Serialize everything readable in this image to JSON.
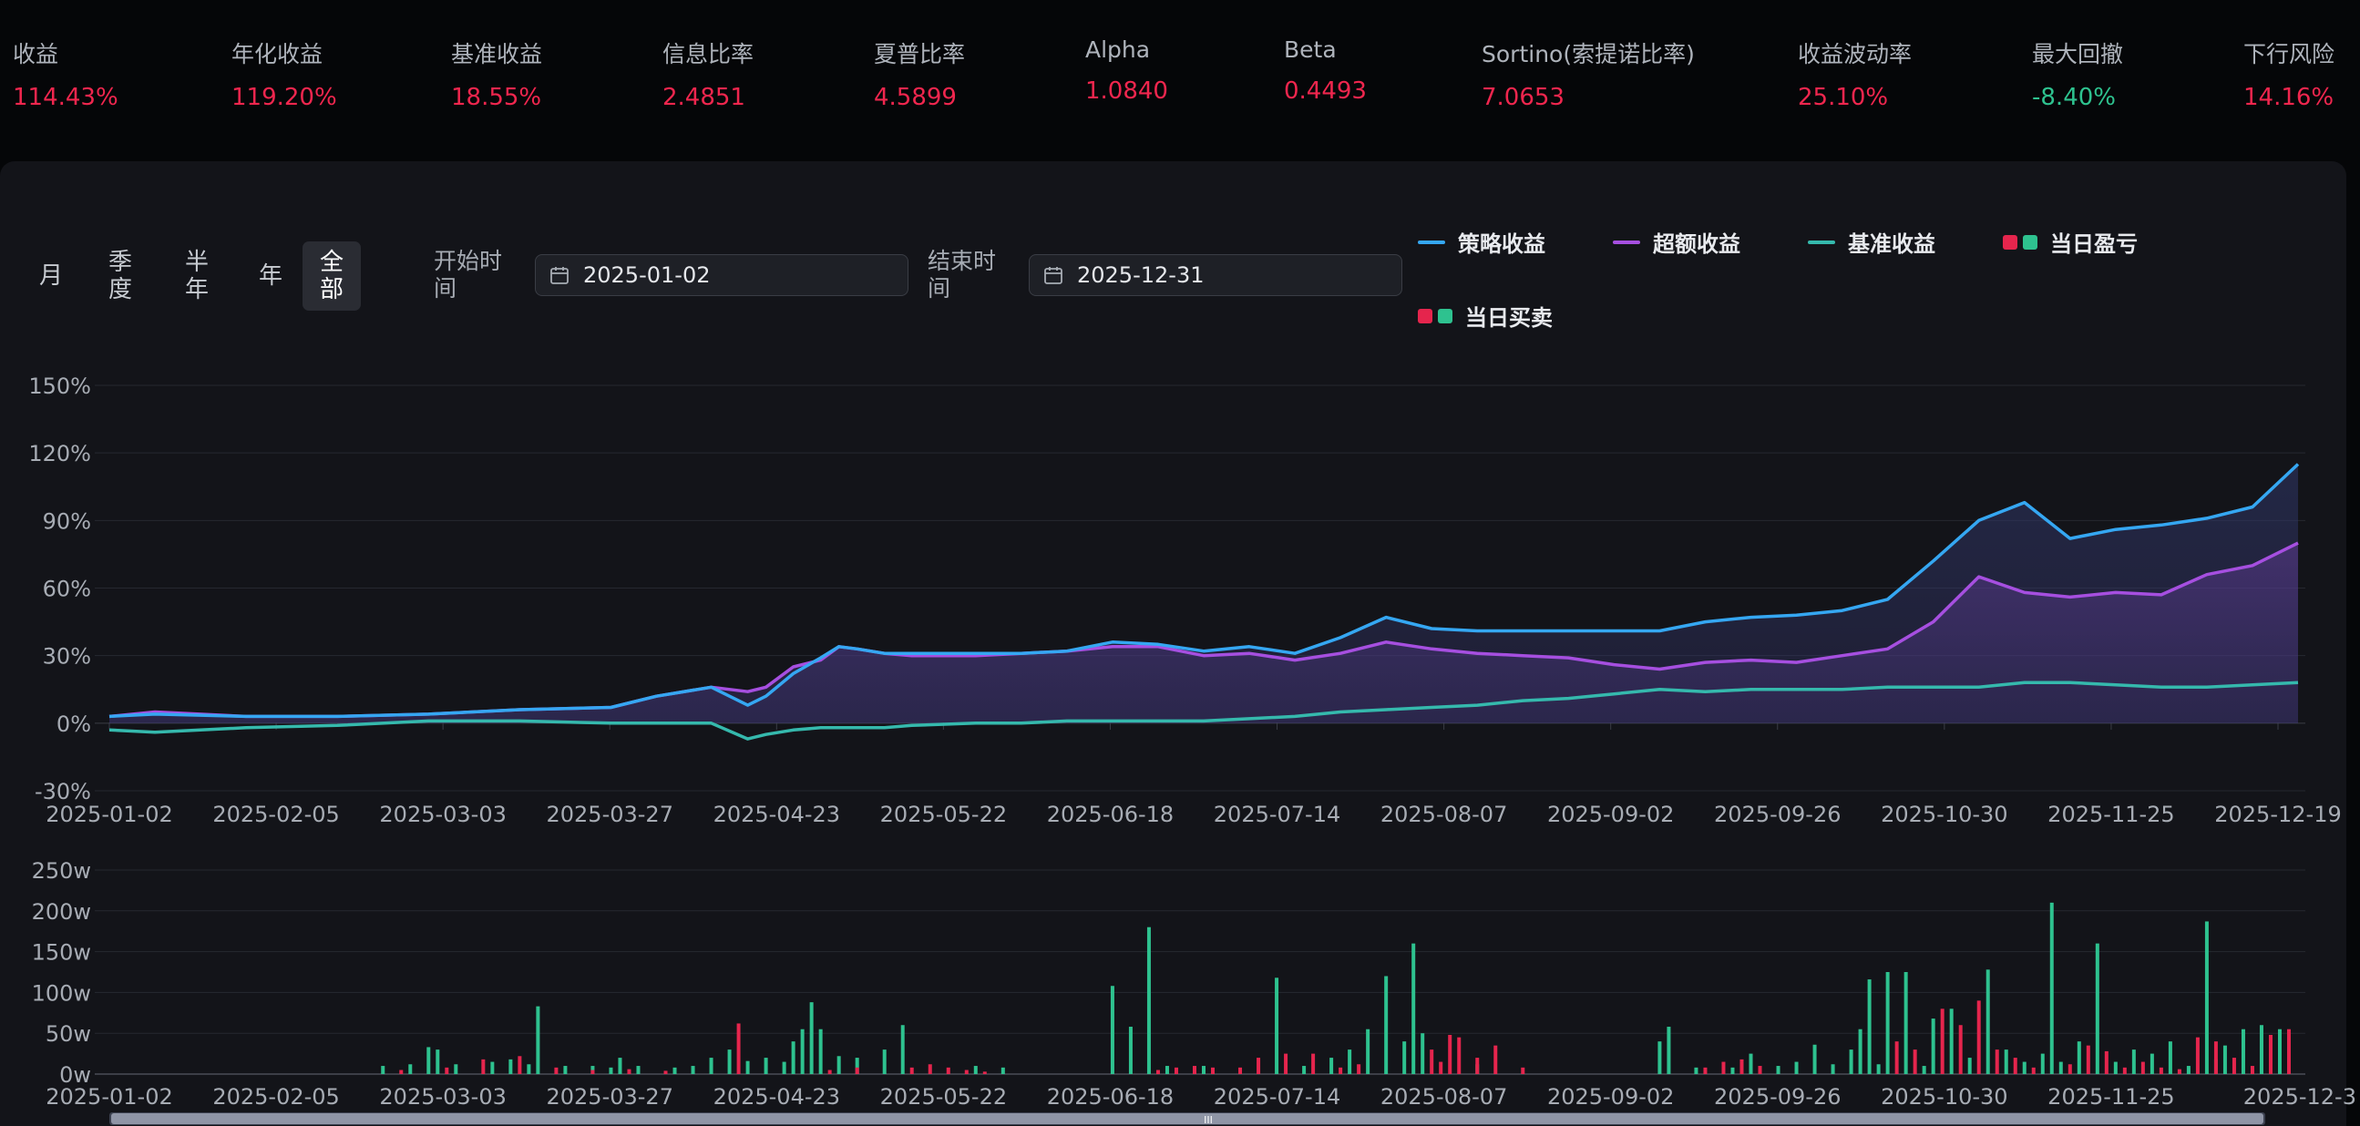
{
  "metrics": [
    {
      "label": "收益",
      "value": "114.43%",
      "color": "#f0264e"
    },
    {
      "label": "年化收益",
      "value": "119.20%",
      "color": "#f0264e"
    },
    {
      "label": "基准收益",
      "value": "18.55%",
      "color": "#f0264e"
    },
    {
      "label": "信息比率",
      "value": "2.4851",
      "color": "#f0264e"
    },
    {
      "label": "夏普比率",
      "value": "4.5899",
      "color": "#f0264e"
    },
    {
      "label": "Alpha",
      "value": "1.0840",
      "color": "#f0264e"
    },
    {
      "label": "Beta",
      "value": "0.4493",
      "color": "#f0264e"
    },
    {
      "label": "Sortino(索提诺比率)",
      "value": "7.0653",
      "color": "#f0264e"
    },
    {
      "label": "收益波动率",
      "value": "25.10%",
      "color": "#f0264e"
    },
    {
      "label": "最大回撤",
      "value": "-8.40%",
      "color": "#2ec28f"
    },
    {
      "label": "下行风险",
      "value": "14.16%",
      "color": "#f0264e"
    }
  ],
  "period_tabs": {
    "month": "月",
    "quarter_1": "季",
    "quarter_2": "度",
    "half_1": "半",
    "half_2": "年",
    "year": "年",
    "all_1": "全",
    "all_2": "部",
    "active": "全部"
  },
  "date_range": {
    "start_label_1": "开始时",
    "start_label_2": "间",
    "start_value": "2025-01-02",
    "end_label_1": "结束时",
    "end_label_2": "间",
    "end_value": "2025-12-31",
    "icon": "calendar-icon"
  },
  "legend": {
    "strategy": "策略收益",
    "excess": "超额收益",
    "benchmark": "基准收益",
    "daily_pnl": "当日盈亏",
    "daily_trade": "当日买卖"
  },
  "colors": {
    "strategy": "#35a7f2",
    "excess": "#a64fe0",
    "benchmark": "#35b9ad",
    "up": "#e5254d",
    "down": "#2ec28f"
  },
  "scrollbar_handle_label": "III",
  "chart_data": [
    {
      "type": "line",
      "x_tick_labels": [
        "2025-01-02",
        "2025-02-05",
        "2025-03-03",
        "2025-03-27",
        "2025-04-23",
        "2025-05-22",
        "2025-06-18",
        "2025-07-14",
        "2025-08-07",
        "2025-09-02",
        "2025-09-26",
        "2025-10-30",
        "2025-11-25",
        "2025-12-19"
      ],
      "y_tick_labels": [
        "150%",
        "120%",
        "90%",
        "60%",
        "30%",
        "0%",
        "-30%"
      ],
      "ylim": [
        -30,
        150
      ],
      "x_index_range": [
        0,
        240
      ],
      "grid": true,
      "legend_position": "top-right",
      "series": [
        {
          "name": "策略收益",
          "x": [
            0,
            5,
            15,
            25,
            35,
            45,
            55,
            60,
            66,
            70,
            72,
            75,
            78,
            80,
            82,
            85,
            88,
            95,
            100,
            105,
            110,
            115,
            120,
            125,
            130,
            135,
            140,
            145,
            150,
            155,
            160,
            165,
            170,
            175,
            180,
            185,
            190,
            195,
            200,
            205,
            210,
            215,
            220,
            225,
            230,
            235,
            240
          ],
          "y": [
            3,
            4,
            3,
            3,
            4,
            6,
            7,
            12,
            16,
            8,
            12,
            22,
            29,
            34,
            33,
            31,
            31,
            31,
            31,
            32,
            36,
            35,
            32,
            34,
            31,
            38,
            47,
            42,
            41,
            41,
            41,
            41,
            41,
            45,
            47,
            48,
            50,
            55,
            72,
            90,
            98,
            82,
            86,
            88,
            91,
            96,
            115
          ]
        },
        {
          "name": "超额收益",
          "x": [
            0,
            5,
            15,
            25,
            35,
            45,
            55,
            60,
            66,
            70,
            72,
            75,
            78,
            80,
            82,
            85,
            88,
            95,
            100,
            105,
            110,
            115,
            120,
            125,
            130,
            135,
            140,
            145,
            150,
            155,
            160,
            165,
            170,
            175,
            180,
            185,
            190,
            195,
            200,
            205,
            210,
            215,
            220,
            225,
            230,
            235,
            240
          ],
          "y": [
            3,
            5,
            3,
            3,
            4,
            6,
            7,
            12,
            16,
            14,
            16,
            25,
            28,
            34,
            33,
            31,
            30,
            30,
            31,
            32,
            34,
            34,
            30,
            31,
            28,
            31,
            36,
            33,
            31,
            30,
            29,
            26,
            24,
            27,
            28,
            27,
            30,
            33,
            45,
            65,
            58,
            56,
            58,
            57,
            66,
            70,
            80
          ]
        },
        {
          "name": "基准收益",
          "x": [
            0,
            5,
            15,
            25,
            35,
            45,
            55,
            60,
            66,
            70,
            72,
            75,
            78,
            80,
            82,
            85,
            88,
            95,
            100,
            105,
            110,
            115,
            120,
            125,
            130,
            135,
            140,
            145,
            150,
            155,
            160,
            165,
            170,
            175,
            180,
            185,
            190,
            195,
            200,
            205,
            210,
            215,
            220,
            225,
            230,
            235,
            240
          ],
          "y": [
            -3,
            -4,
            -2,
            -1,
            1,
            1,
            0,
            0,
            0,
            -7,
            -5,
            -3,
            -2,
            -2,
            -2,
            -2,
            -1,
            0,
            0,
            1,
            1,
            1,
            1,
            2,
            3,
            5,
            6,
            7,
            8,
            10,
            11,
            13,
            15,
            14,
            15,
            15,
            15,
            16,
            16,
            16,
            18,
            18,
            17,
            16,
            16,
            17,
            18
          ]
        }
      ]
    },
    {
      "type": "bar",
      "y_tick_labels": [
        "250w",
        "200w",
        "150w",
        "100w",
        "50w",
        "0w"
      ],
      "ylim": [
        0,
        250
      ],
      "unit": "w",
      "x_tick_labels": [
        "2025-01-02",
        "2025-02-05",
        "2025-03-03",
        "2025-03-27",
        "2025-04-23",
        "2025-05-22",
        "2025-06-18",
        "2025-07-14",
        "2025-08-07",
        "2025-09-02",
        "2025-09-26",
        "2025-10-30",
        "2025-11-25",
        "2025-12-3"
      ],
      "series": [
        {
          "name": "买入",
          "color": "down",
          "points": [
            [
              30,
              10
            ],
            [
              33,
              12
            ],
            [
              35,
              33
            ],
            [
              36,
              30
            ],
            [
              38,
              12
            ],
            [
              42,
              15
            ],
            [
              44,
              18
            ],
            [
              46,
              12
            ],
            [
              47,
              83
            ],
            [
              50,
              10
            ],
            [
              53,
              10
            ],
            [
              55,
              8
            ],
            [
              56,
              20
            ],
            [
              58,
              10
            ],
            [
              62,
              8
            ],
            [
              64,
              10
            ],
            [
              66,
              20
            ],
            [
              68,
              30
            ],
            [
              70,
              16
            ],
            [
              72,
              20
            ],
            [
              74,
              15
            ],
            [
              75,
              40
            ],
            [
              76,
              55
            ],
            [
              77,
              88
            ],
            [
              78,
              55
            ],
            [
              80,
              22
            ],
            [
              82,
              20
            ],
            [
              85,
              30
            ],
            [
              87,
              60
            ],
            [
              95,
              10
            ],
            [
              98,
              8
            ],
            [
              110,
              108
            ],
            [
              112,
              58
            ],
            [
              114,
              180
            ],
            [
              116,
              10
            ],
            [
              120,
              10
            ],
            [
              128,
              118
            ],
            [
              131,
              10
            ],
            [
              134,
              20
            ],
            [
              136,
              30
            ],
            [
              138,
              55
            ],
            [
              140,
              120
            ],
            [
              142,
              40
            ],
            [
              143,
              160
            ],
            [
              144,
              50
            ],
            [
              150,
              12
            ],
            [
              170,
              40
            ],
            [
              171,
              58
            ],
            [
              174,
              8
            ],
            [
              178,
              8
            ],
            [
              180,
              25
            ],
            [
              183,
              10
            ],
            [
              185,
              15
            ],
            [
              187,
              36
            ],
            [
              189,
              12
            ],
            [
              191,
              30
            ],
            [
              192,
              55
            ],
            [
              193,
              116
            ],
            [
              194,
              12
            ],
            [
              195,
              125
            ],
            [
              197,
              125
            ],
            [
              199,
              10
            ],
            [
              200,
              68
            ],
            [
              202,
              80
            ],
            [
              204,
              20
            ],
            [
              206,
              128
            ],
            [
              208,
              30
            ],
            [
              210,
              15
            ],
            [
              212,
              25
            ],
            [
              213,
              210
            ],
            [
              214,
              15
            ],
            [
              216,
              40
            ],
            [
              218,
              160
            ],
            [
              220,
              15
            ],
            [
              222,
              30
            ],
            [
              224,
              25
            ],
            [
              226,
              40
            ],
            [
              228,
              10
            ],
            [
              230,
              187
            ],
            [
              231,
              18
            ],
            [
              232,
              35
            ],
            [
              234,
              55
            ],
            [
              236,
              60
            ],
            [
              238,
              55
            ],
            [
              239,
              50
            ]
          ]
        },
        {
          "name": "卖出",
          "color": "up",
          "points": [
            [
              32,
              5
            ],
            [
              37,
              8
            ],
            [
              41,
              18
            ],
            [
              45,
              22
            ],
            [
              49,
              8
            ],
            [
              53,
              5
            ],
            [
              57,
              6
            ],
            [
              61,
              4
            ],
            [
              69,
              62
            ],
            [
              79,
              5
            ],
            [
              82,
              8
            ],
            [
              88,
              8
            ],
            [
              90,
              12
            ],
            [
              92,
              8
            ],
            [
              94,
              5
            ],
            [
              96,
              3
            ],
            [
              115,
              5
            ],
            [
              117,
              8
            ],
            [
              119,
              10
            ],
            [
              121,
              8
            ],
            [
              124,
              8
            ],
            [
              126,
              20
            ],
            [
              129,
              25
            ],
            [
              132,
              25
            ],
            [
              135,
              8
            ],
            [
              137,
              12
            ],
            [
              145,
              30
            ],
            [
              146,
              15
            ],
            [
              147,
              48
            ],
            [
              148,
              45
            ],
            [
              150,
              20
            ],
            [
              152,
              35
            ],
            [
              155,
              8
            ],
            [
              175,
              8
            ],
            [
              177,
              15
            ],
            [
              179,
              18
            ],
            [
              181,
              10
            ],
            [
              196,
              40
            ],
            [
              198,
              30
            ],
            [
              201,
              80
            ],
            [
              203,
              60
            ],
            [
              205,
              90
            ],
            [
              207,
              30
            ],
            [
              209,
              20
            ],
            [
              211,
              8
            ],
            [
              215,
              12
            ],
            [
              217,
              35
            ],
            [
              219,
              28
            ],
            [
              221,
              8
            ],
            [
              223,
              15
            ],
            [
              225,
              8
            ],
            [
              227,
              6
            ],
            [
              229,
              45
            ],
            [
              231,
              40
            ],
            [
              233,
              20
            ],
            [
              235,
              10
            ],
            [
              237,
              48
            ],
            [
              239,
              55
            ]
          ]
        }
      ]
    }
  ]
}
